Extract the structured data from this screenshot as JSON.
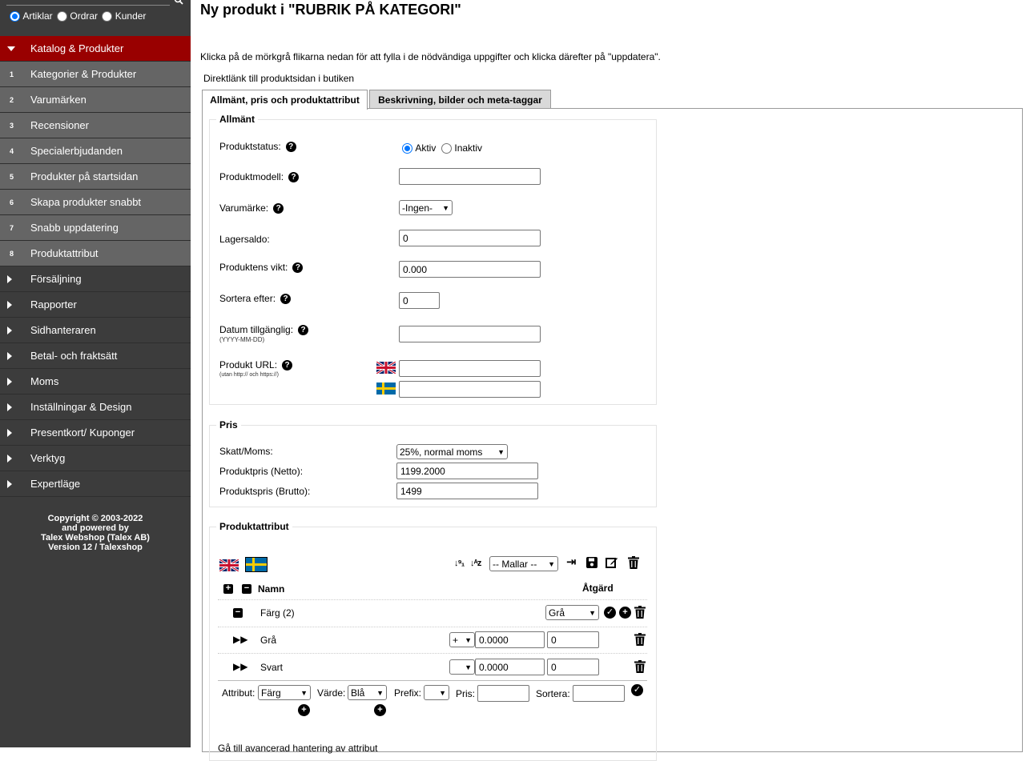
{
  "sidebar": {
    "search_scope": [
      {
        "label": "Artiklar",
        "checked": true
      },
      {
        "label": "Ordrar",
        "checked": false
      },
      {
        "label": "Kunder",
        "checked": false
      }
    ],
    "menu": [
      {
        "label": "Katalog & Produkter",
        "type": "active"
      },
      {
        "label": "Kategorier & Produkter",
        "num": "1"
      },
      {
        "label": "Varumärken",
        "num": "2"
      },
      {
        "label": "Recensioner",
        "num": "3"
      },
      {
        "label": "Specialerbjudanden",
        "num": "4"
      },
      {
        "label": "Produkter på startsidan",
        "num": "5"
      },
      {
        "label": "Skapa produkter snabbt",
        "num": "6"
      },
      {
        "label": "Snabb uppdatering",
        "num": "7"
      },
      {
        "label": "Produktattribut",
        "num": "8"
      },
      {
        "label": "Försäljning"
      },
      {
        "label": "Rapporter"
      },
      {
        "label": "Sidhanteraren"
      },
      {
        "label": "Betal- och fraktsätt"
      },
      {
        "label": "Moms"
      },
      {
        "label": "Inställningar & Design"
      },
      {
        "label": "Presentkort/ Kuponger"
      },
      {
        "label": "Verktyg"
      },
      {
        "label": "Expertläge"
      }
    ],
    "copyright": [
      "Copyright © 2003-2022",
      "and powered by",
      "Talex Webshop (Talex AB)",
      "Version 12 / Talexshop"
    ]
  },
  "main": {
    "title": "Ny produkt i \"RUBRIK PÅ KATEGORI\"",
    "intro": "Klicka på de mörkgrå flikarna nedan för att fylla i de nödvändiga uppgifter och klicka därefter på \"uppdatera\".",
    "direct_link": "Direktlänk till produktsidan i butiken",
    "tabs": [
      "Allmänt, pris och produktattribut",
      "Beskrivning, bilder och meta-taggar"
    ],
    "general": {
      "legend": "Allmänt",
      "status_label": "Produktstatus:",
      "status_active": "Aktiv",
      "status_inactive": "Inaktiv",
      "model_label": "Produktmodell:",
      "model_value": "",
      "brand_label": "Varumärke:",
      "brand_value": "-Ingen-",
      "stock_label": "Lagersaldo:",
      "stock_value": "0",
      "weight_label": "Produktens vikt:",
      "weight_value": "0.000",
      "sort_label": "Sortera efter:",
      "sort_value": "0",
      "date_label": "Datum tillgänglig:",
      "date_note": "(YYYY-MM-DD)",
      "date_value": "",
      "url_label": "Produkt URL:",
      "url_note": "(utan http:// och https://)",
      "url_en": "",
      "url_sv": ""
    },
    "price": {
      "legend": "Pris",
      "tax_label": "Skatt/Moms:",
      "tax_value": "25%, normal moms",
      "net_label": "Produktpris (Netto):",
      "net_value": "1199.2000",
      "gross_label": "Produktspris (Brutto):",
      "gross_value": "1499"
    },
    "attributes": {
      "legend": "Produktattribut",
      "templates_value": "-- Mallar --",
      "col_name": "Namn",
      "col_action": "Åtgärd",
      "group": {
        "name": "Färg (2)",
        "select_value": "Grå"
      },
      "rows": [
        {
          "name": "Grå",
          "prefix": "+",
          "price": "0.0000",
          "sort": "0"
        },
        {
          "name": "Svart",
          "prefix": "",
          "price": "0.0000",
          "sort": "0"
        }
      ],
      "add": {
        "attr_label": "Attribut:",
        "attr_value": "Färg",
        "value_label": "Värde:",
        "value_value": "Blå",
        "prefix_label": "Prefix:",
        "prefix_value": "",
        "price_label": "Pris:",
        "price_value": "",
        "sort_label": "Sortera:",
        "sort_value": ""
      },
      "advanced_link": "Gå till avancerad hantering av attribut"
    }
  }
}
